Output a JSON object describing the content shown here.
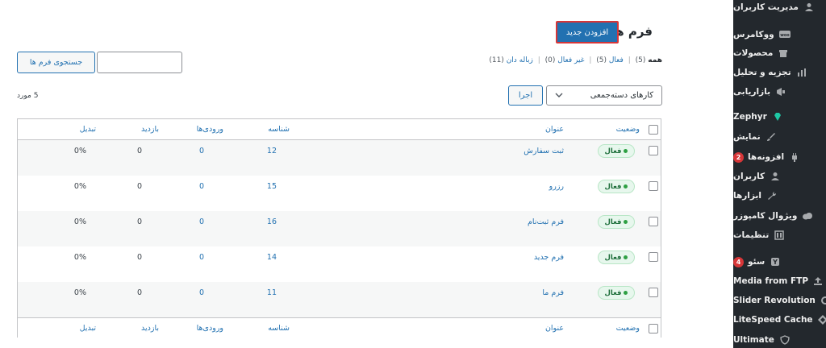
{
  "page": {
    "title": "فرم ها",
    "add_new_label": "افزودن جدید",
    "search_button_label": "جستجوی فرم ها",
    "search_value": ""
  },
  "filters": {
    "all_label": "همه",
    "all_count": "(5)",
    "active_label": "فعال",
    "active_count": "(5)",
    "inactive_label": "غیر فعال",
    "inactive_count": "(0)",
    "trash_label": "زباله دان",
    "trash_count": "(11)",
    "separator": "|"
  },
  "bulk": {
    "selected_label": "کارهای دسته‌جمعی",
    "apply_label": "اجرا",
    "items_count": "5 مورد"
  },
  "table": {
    "columns": {
      "status": "وضعیت",
      "title": "عنوان",
      "id": "شناسه",
      "entries": "ورودی‌ها",
      "views": "بازدید",
      "conversion": "تبدیل"
    },
    "rows": [
      {
        "status": "فعال",
        "title": "ثبت سفارش",
        "id": "12",
        "entries": "0",
        "views": "0",
        "conversion": "0%"
      },
      {
        "status": "فعال",
        "title": "رزرو",
        "id": "15",
        "entries": "0",
        "views": "0",
        "conversion": "0%"
      },
      {
        "status": "فعال",
        "title": "فرم ثبت‌نام",
        "id": "16",
        "entries": "0",
        "views": "0",
        "conversion": "0%"
      },
      {
        "status": "فعال",
        "title": "فرم جدید",
        "id": "14",
        "entries": "0",
        "views": "0",
        "conversion": "0%"
      },
      {
        "status": "فعال",
        "title": "فرم ما",
        "id": "11",
        "entries": "0",
        "views": "0",
        "conversion": "0%"
      }
    ]
  },
  "sidebar": {
    "items": [
      {
        "label": "مدیریت کاربران",
        "icon": "user-icon"
      },
      {
        "label": "ووکامرس",
        "icon": "woo-icon"
      },
      {
        "label": "محصولات",
        "icon": "archive-icon"
      },
      {
        "label": "تجزیه و تحلیل",
        "icon": "bar-chart-icon"
      },
      {
        "label": "بازاریابی",
        "icon": "megaphone-icon"
      },
      {
        "label": "Zephyr",
        "icon": "gem-icon"
      },
      {
        "label": "نمایش",
        "icon": "brush-icon"
      },
      {
        "label": "افزونه‌ها",
        "icon": "plugin-icon",
        "badge": "2"
      },
      {
        "label": "کاربران",
        "icon": "users-icon"
      },
      {
        "label": "ابزارها",
        "icon": "wrench-icon"
      },
      {
        "label": "ویژوال کامپوزر",
        "icon": "cloud-icon"
      },
      {
        "label": "تنظیمات",
        "icon": "settings-icon"
      },
      {
        "label": "سئو",
        "icon": "yoast-icon",
        "badge": "4"
      },
      {
        "label": "Media from FTP",
        "icon": "upload-icon"
      },
      {
        "label": "Slider Revolution",
        "icon": "refresh-icon"
      },
      {
        "label": "LiteSpeed Cache",
        "icon": "diamond-icon"
      },
      {
        "label": "Ultimate",
        "icon": "shield-icon"
      }
    ]
  },
  "colors": {
    "accent": "#2271b1",
    "sidebar_bg": "#23282d",
    "highlight_border": "#d63638",
    "active_badge_bg": "#e7f7ed"
  }
}
